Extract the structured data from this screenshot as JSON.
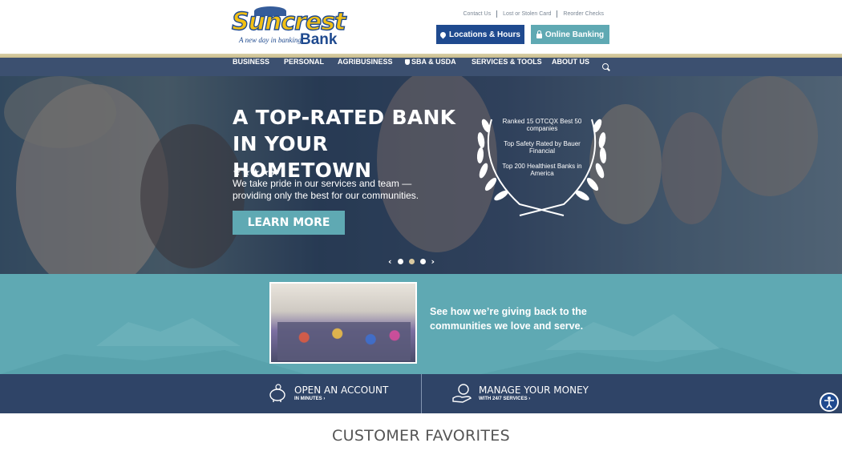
{
  "header": {
    "logo": {
      "wordmark": "Suncrest",
      "tagline": "A new day in banking",
      "bank": "Bank"
    },
    "utility_links": [
      "Contact Us",
      "Lost or Stolen Card",
      "Reorder Checks"
    ],
    "locations_button": "Locations & Hours",
    "online_banking_button": "Online Banking"
  },
  "nav": {
    "items": [
      "BUSINESS",
      "PERSONAL",
      "AGRIBUSINESS",
      "SBA & USDA",
      "SERVICES & TOOLS",
      "ABOUT US"
    ]
  },
  "hero": {
    "title": "A TOP-RATED BANK IN YOUR HOMETOWN",
    "stars": "★★★★★",
    "text": "We take pride in our services and team — providing only the best for our communities.",
    "cta": "LEARN MORE",
    "award_lines": [
      "Ranked 15 OTCQX Best 50 companies",
      "Top Safety Rated by Bauer Financial",
      "Top 200 Healthiest Banks in America"
    ],
    "slides": 3,
    "active_slide": 2
  },
  "community": {
    "text": "See how we’re giving back to the communities we love and serve."
  },
  "actions": {
    "open": {
      "title": "OPEN AN ACCOUNT",
      "sub": "IN MINUTES"
    },
    "manage": {
      "title": "MANAGE YOUR MONEY",
      "sub": "WITH 24/7 SERVICES"
    }
  },
  "favorites": {
    "heading": "CUSTOMER FAVORITES"
  },
  "colors": {
    "navy": "#1f4a8f",
    "teal": "#5fa9b3",
    "nav": "#3c5070",
    "gold": "#f2c014"
  }
}
